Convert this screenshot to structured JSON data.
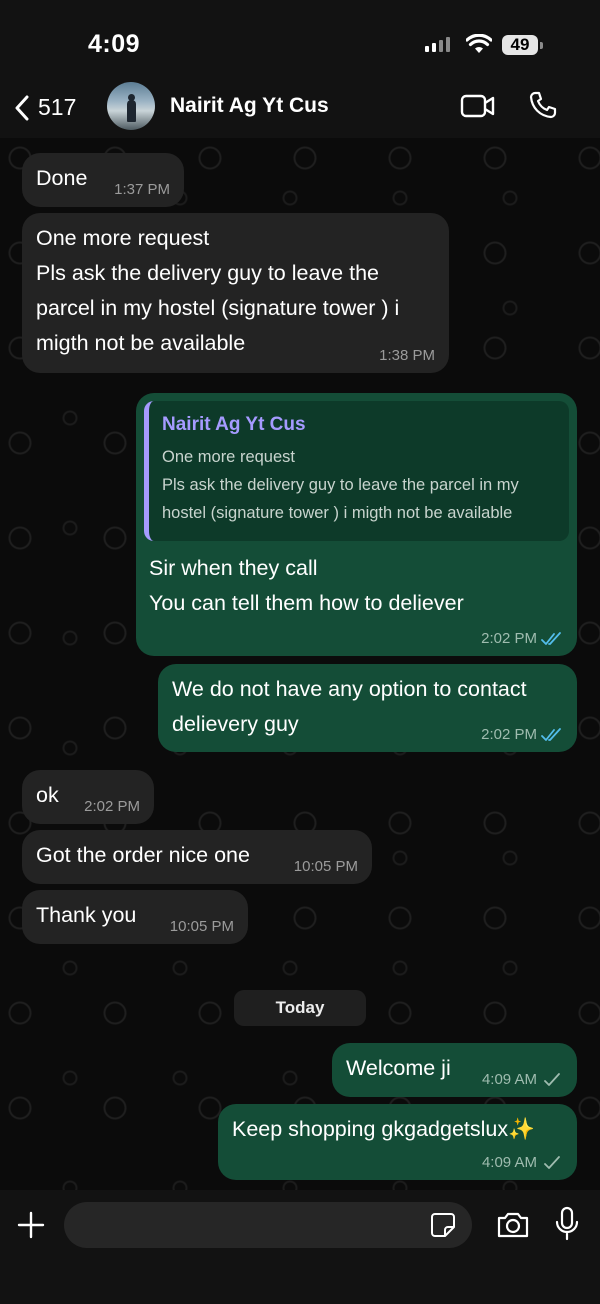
{
  "status_bar": {
    "time": "4:09",
    "battery": "49"
  },
  "header": {
    "back_count": "517",
    "contact_name": "Nairit Ag Yt Cus"
  },
  "messages": [
    {
      "text": "Done",
      "time": "1:37 PM"
    },
    {
      "text": "One more request\nPls ask the delivery guy to leave the\nparcel in my hostel (signature tower ) i\nmigth not be available",
      "time": "1:38 PM"
    },
    {
      "quote_name": "Nairit Ag Yt Cus",
      "quote_text": "One more request\nPls ask the delivery guy to leave the parcel in my\nhostel (signature tower ) i migth not be available",
      "text": "Sir when they call\nYou can tell them how to deliever",
      "time": "2:02 PM"
    },
    {
      "text": "We do not have any option to contact\ndelievery guy",
      "time": "2:02 PM"
    },
    {
      "text": "ok",
      "time": "2:02 PM"
    },
    {
      "text": "Got the order nice one",
      "time": "10:05 PM"
    },
    {
      "text": "Thank you",
      "time": "10:05 PM"
    },
    {
      "text": "Welcome ji",
      "time": "4:09 AM"
    },
    {
      "text": "Keep shopping gkgadgetslux✨",
      "time": "4:09 AM"
    }
  ],
  "day_label": "Today",
  "colors": {
    "incoming": "#232323",
    "outgoing": "#144d37",
    "read_tick": "#53bdeb",
    "quote_accent": "#a59bff"
  }
}
